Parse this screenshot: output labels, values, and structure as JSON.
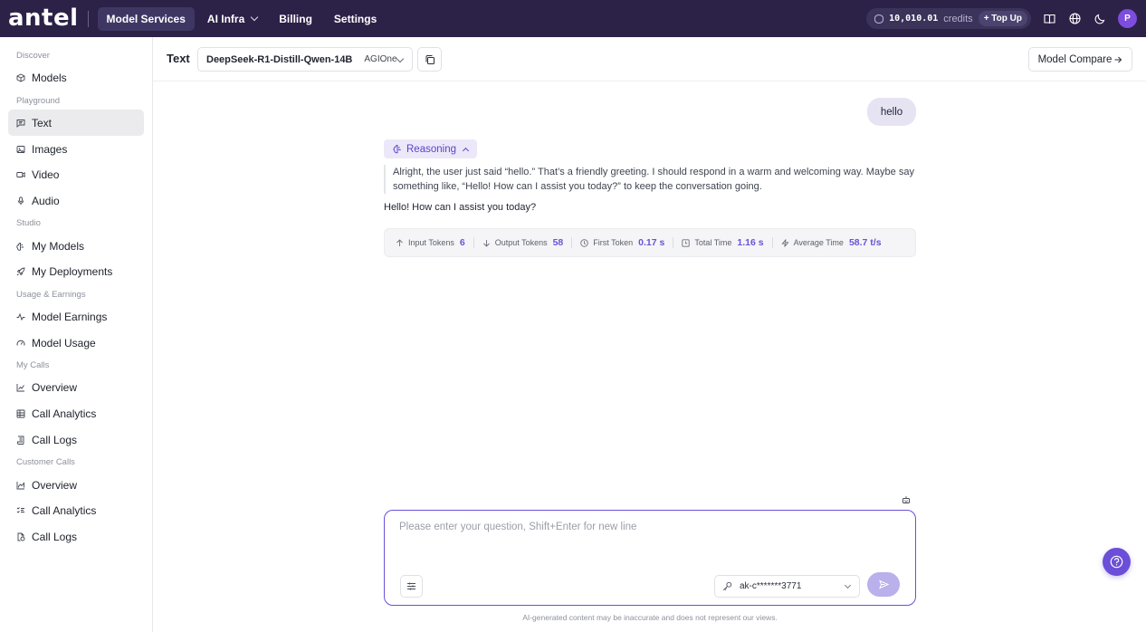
{
  "colors": {
    "topbar": "#2c2147",
    "accent": "#6b4fd8",
    "reasoning": "#5b43c9"
  },
  "topbar": {
    "logo": "antel",
    "nav": [
      {
        "label": "Model Services",
        "active": true
      },
      {
        "label": "AI Infra",
        "dropdown": true
      },
      {
        "label": "Billing"
      },
      {
        "label": "Settings"
      }
    ],
    "credits_value": "10,010.01",
    "credits_unit": "credits",
    "topup_label": "+ Top Up",
    "avatar": "P",
    "icons": [
      "book-icon",
      "globe-icon",
      "moon-icon"
    ]
  },
  "sidebar": {
    "discover": "Discover",
    "models": "Models",
    "playground": "Playground",
    "text": "Text",
    "images": "Images",
    "video": "Video",
    "audio": "Audio",
    "studio": "Studio",
    "my_models": "My Models",
    "my_deployments": "My Deployments",
    "usage_earnings": "Usage & Earnings",
    "model_earnings": "Model Earnings",
    "model_usage": "Model Usage",
    "my_calls": "My Calls",
    "mc_overview": "Overview",
    "mc_call_analytics": "Call Analytics",
    "mc_call_logs": "Call Logs",
    "customer_calls": "Customer Calls",
    "cc_overview": "Overview",
    "cc_call_analytics": "Call Analytics",
    "cc_call_logs": "Call Logs"
  },
  "header": {
    "title": "Text",
    "model_name": "DeepSeek-R1-Distill-Qwen-14B",
    "provider": "AGIOne",
    "compare_label": "Model Compare"
  },
  "chat": {
    "user_message": "hello",
    "reasoning_label": "Reasoning",
    "reasoning_text": "Alright, the user just said “hello.” That’s a friendly greeting. I should respond in a warm and welcoming way. Maybe say something like, “Hello! How can I assist you today?” to keep the conversation going.",
    "answer": "Hello! How can I assist you today?",
    "stats": [
      {
        "label": "Input Tokens",
        "value": "6"
      },
      {
        "label": "Output Tokens",
        "value": "58"
      },
      {
        "label": "First Token",
        "value": "0.17 s"
      },
      {
        "label": "Total Time",
        "value": "1.16 s"
      },
      {
        "label": "Average Time",
        "value": "58.7 t/s"
      }
    ]
  },
  "composer": {
    "placeholder": "Please enter your question, Shift+Enter for new line",
    "value": "",
    "api_key": "ak-c*******3771",
    "disclaimer": "AI-generated content may be inaccurate and does not represent our views."
  }
}
